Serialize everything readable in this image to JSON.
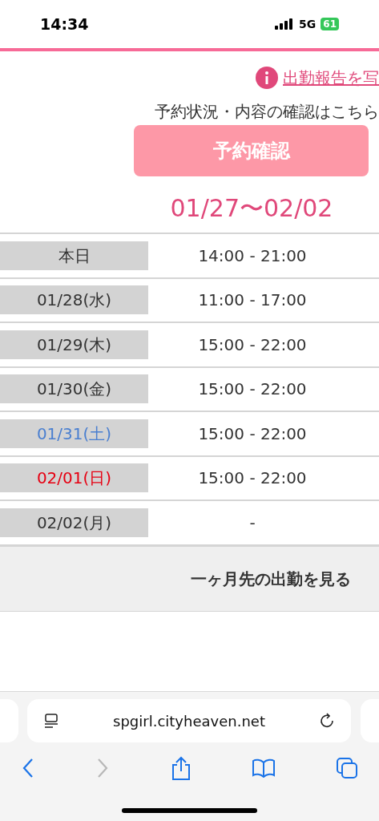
{
  "status_bar": {
    "time": "14:34",
    "network": "5G",
    "battery": "61"
  },
  "notice_link": "出勤報告を写",
  "reservation": {
    "prompt": "予約状況・内容の確認はこちら",
    "button": "予約確認"
  },
  "week_range": "01/27〜02/02",
  "schedule": [
    {
      "day": "本日",
      "kind": "weekday",
      "hours": "14:00 - 21:00"
    },
    {
      "day": "01/28(水)",
      "kind": "weekday",
      "hours": "11:00 - 17:00"
    },
    {
      "day": "01/29(木)",
      "kind": "weekday",
      "hours": "15:00 - 22:00"
    },
    {
      "day": "01/30(金)",
      "kind": "weekday",
      "hours": "15:00 - 22:00"
    },
    {
      "day": "01/31(土)",
      "kind": "saturday",
      "hours": "15:00 - 22:00"
    },
    {
      "day": "02/01(日)",
      "kind": "sunday",
      "hours": "15:00 - 22:00"
    },
    {
      "day": "02/02(月)",
      "kind": "weekday",
      "hours": "-"
    }
  ],
  "more_button": "一ヶ月先の出勤を見る",
  "browser": {
    "url": "spgirl.cityheaven.net"
  }
}
